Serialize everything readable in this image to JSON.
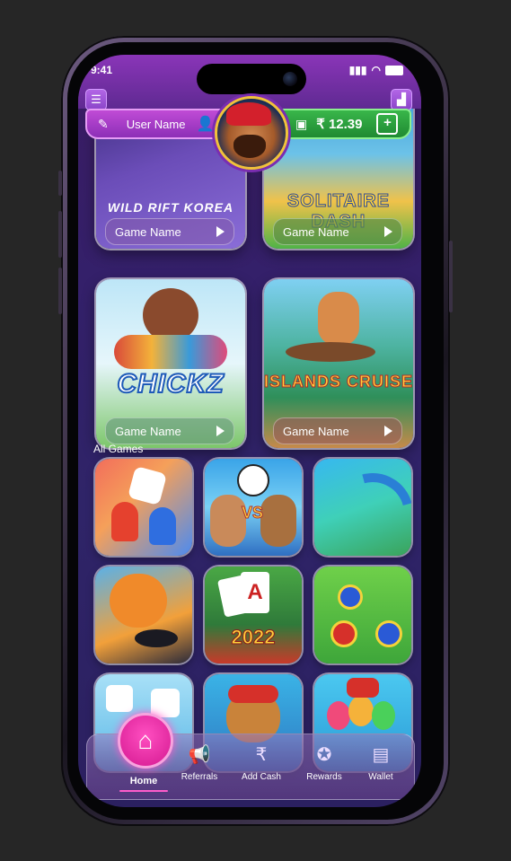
{
  "status": {
    "time": "9:41"
  },
  "header": {
    "menu_icon": "hamburger-icon",
    "leaderboard_icon": "leaderboard-icon",
    "user_name": "User Name",
    "balance": "₹ 12.39",
    "add_label": "+"
  },
  "featured": [
    {
      "game_name": "Game Name",
      "art_text": "WILD RIFT KOREA"
    },
    {
      "game_name": "Game Name",
      "art_text": "SOLITAIRE DASH"
    },
    {
      "game_name": "Game Name",
      "art_text": "CHICKZ"
    },
    {
      "game_name": "Game Name",
      "art_text": "ISLANDS CRUISE"
    }
  ],
  "all_games": {
    "title": "All Games",
    "tiles": [
      {
        "icon": "ludo-icon",
        "art_text": ""
      },
      {
        "icon": "soccer-heads-icon",
        "art_text": "VS"
      },
      {
        "icon": "parkour-icon",
        "art_text": ""
      },
      {
        "icon": "tiger-hockey-icon",
        "art_text": ""
      },
      {
        "icon": "solitaire-icon",
        "art_text": "2022"
      },
      {
        "icon": "finger-soccer-icon",
        "art_text": ""
      },
      {
        "icon": "dice-icon",
        "art_text": ""
      },
      {
        "icon": "santa-cat-icon",
        "art_text": ""
      },
      {
        "icon": "candy-icon",
        "art_text": ""
      }
    ]
  },
  "nav": {
    "home": "Home",
    "referrals": "Referrals",
    "add_cash": "Add Cash",
    "rewards": "Rewards",
    "wallet": "Wallet"
  },
  "colors": {
    "accent_pink": "#ff4fc1",
    "wallet_green": "#39b64a",
    "user_purple": "#c04bd6"
  }
}
